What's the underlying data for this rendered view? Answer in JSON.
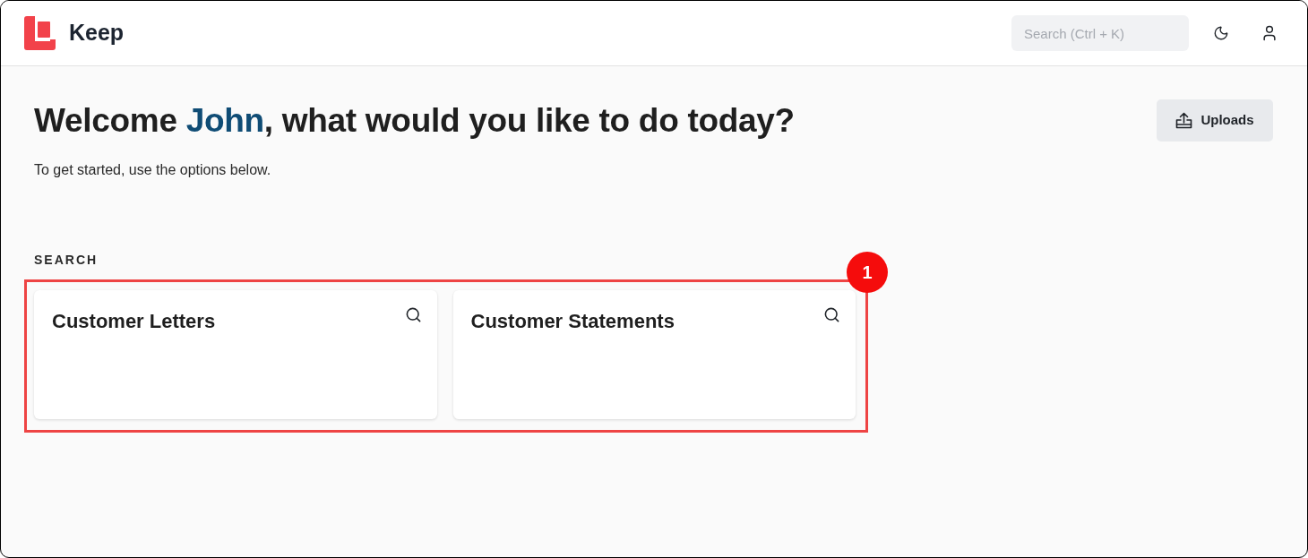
{
  "header": {
    "app_name": "Keep",
    "search": {
      "placeholder": "Search (Ctrl + K)"
    }
  },
  "welcome": {
    "greeting": "Welcome ",
    "name": "John",
    "rest": ", what would you like to do today?",
    "subtitle": "To get started, use the options below."
  },
  "uploads_button": {
    "label": "Uploads"
  },
  "search_section": {
    "title": "SEARCH",
    "cards": [
      {
        "title": "Customer Letters"
      },
      {
        "title": "Customer Statements"
      }
    ]
  },
  "annotation": {
    "number": "1"
  }
}
